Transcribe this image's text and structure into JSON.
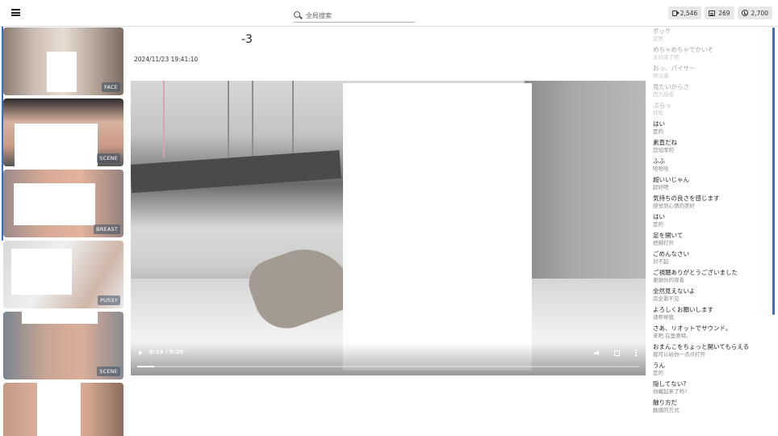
{
  "header": {
    "menu_icon": "hamburger-icon",
    "search": {
      "placeholder": "全局搜索",
      "icon": "search-icon"
    },
    "stats": [
      {
        "icon": "video-icon",
        "value": "2,546"
      },
      {
        "icon": "image-icon",
        "value": "269"
      },
      {
        "icon": "clock-icon",
        "value": "2,700"
      }
    ]
  },
  "sidebar": {
    "accent_color": "#2f6fd6",
    "thumbnails": [
      {
        "tag": "FACE"
      },
      {
        "tag": "SCENE"
      },
      {
        "tag": "BREAST"
      },
      {
        "tag": "PUSSY"
      },
      {
        "tag": "SCENE"
      },
      {
        "tag": ""
      }
    ]
  },
  "main": {
    "title": "-3",
    "date": "2024/11/23 19:41:10",
    "player": {
      "time": "0:19 / 9:20",
      "progress": 0.034,
      "icons": [
        "play-icon",
        "volume-icon",
        "fullscreen-icon",
        "more-vert-icon"
      ]
    }
  },
  "subtitles": [
    {
      "jp": "ボッケ",
      "cn": "泥死",
      "past": true
    },
    {
      "jp": "めちゃめちゃでかいぞ",
      "cn": "太历害了吧",
      "past": true
    },
    {
      "jp": "おっ、パイサー",
      "cn": "啊派塞",
      "past": true
    },
    {
      "jp": "見たいからさ",
      "cn": "因为想看",
      "past": true
    },
    {
      "jp": "ぷらっ",
      "cn": "拜啦",
      "past": true
    },
    {
      "jp": "はい",
      "cn": "是的",
      "past": false
    },
    {
      "jp": "素直だね",
      "cn": "您坦率的",
      "past": false
    },
    {
      "jp": "ふふ",
      "cn": "哈哈哈",
      "past": false
    },
    {
      "jp": "超いいじゃん",
      "cn": "超好吧",
      "past": false
    },
    {
      "jp": "気持ちの良さを感じます",
      "cn": "感觉到心情的美好",
      "past": false
    },
    {
      "jp": "はい",
      "cn": "是的",
      "past": false
    },
    {
      "jp": "足を開いて",
      "cn": "把脚打开",
      "past": false
    },
    {
      "jp": "ごめんなさい",
      "cn": "对不起",
      "past": false
    },
    {
      "jp": "ご視聴ありがとうございました",
      "cn": "谢谢你的观看",
      "past": false
    },
    {
      "jp": "全然見えないよ",
      "cn": "完全看不见",
      "past": false
    },
    {
      "jp": "よろしくお願いします",
      "cn": "请帮帮我",
      "past": false
    },
    {
      "jp": "さあ、リオットでサウンド。",
      "cn": "来吧,在里奥特。",
      "past": false
    },
    {
      "jp": "おまんこをちょっと開いてもらえる",
      "cn": "我可以给你一点点打开",
      "past": false
    },
    {
      "jp": "うん",
      "cn": "是的",
      "past": false
    },
    {
      "jp": "隠してない?",
      "cn": "你藏起来了吗?",
      "past": false
    },
    {
      "jp": "触り方だ",
      "cn": "触摸的方式",
      "past": false
    }
  ]
}
